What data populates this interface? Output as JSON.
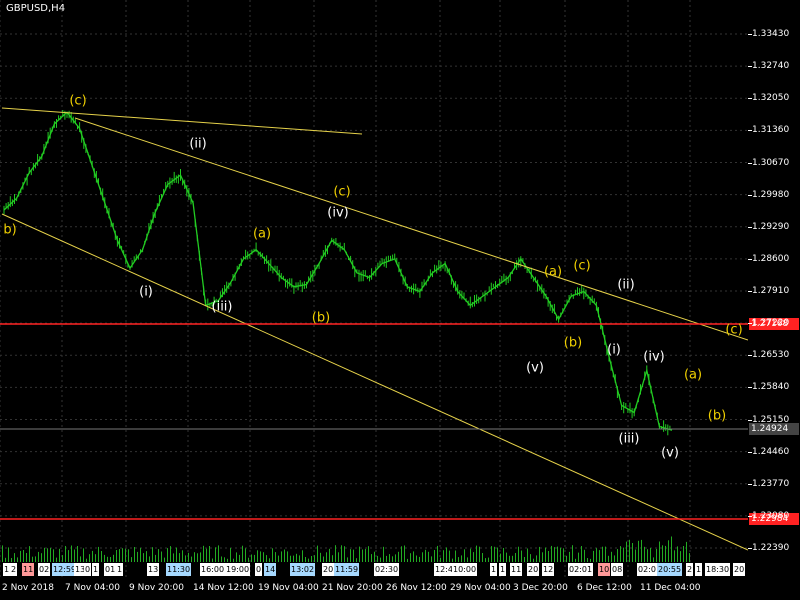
{
  "chart": {
    "title": "GBPUSD,H4",
    "colors": {
      "background": "#000000",
      "bull": "#22cc22",
      "grid": "#3a3a3a",
      "axis": "#ffffff",
      "support": "#ff2222",
      "trend": "#e6d24a",
      "wave_white": "#ffffff",
      "wave_yellow": "#f0d000"
    },
    "current_price": "1.24924",
    "level_upper": "1.27168",
    "level_lower": "1.22984",
    "tick_labels_partial": [
      "1",
      "2",
      "11",
      "02",
      "12:59",
      "13",
      "0",
      "1",
      "01",
      "1",
      "13",
      "11:30",
      "16:00",
      "19:00",
      "0",
      "14",
      "13:02",
      "20",
      "11:59",
      "02:30",
      "12:4",
      "10:00",
      "1",
      "1",
      "11",
      "20",
      "12",
      "02:01",
      "10",
      "08",
      "02:0",
      "20:55",
      "2",
      "1",
      "18:30",
      "20"
    ]
  },
  "chart_data": {
    "type": "candlestick",
    "symbol": "GBPUSD",
    "timeframe": "H4",
    "y_ticks": [
      "1.33430",
      "1.32740",
      "1.32050",
      "1.31360",
      "1.30670",
      "1.29980",
      "1.29290",
      "1.28600",
      "1.27910",
      "1.27220",
      "1.26530",
      "1.25840",
      "1.25150",
      "1.24460",
      "1.23770",
      "1.23080",
      "1.22390"
    ],
    "x_ticks": [
      "2 Nov 2018",
      "7 Nov 04:00",
      "9 Nov 20:00",
      "14 Nov 12:00",
      "19 Nov 04:00",
      "21 Nov 20:00",
      "26 Nov 12:00",
      "29 Nov 04:00",
      "3 Dec 20:00",
      "6 Dec 12:00",
      "11 Dec 04:00"
    ],
    "close_series": [
      1.2965,
      1.299,
      1.3045,
      1.308,
      1.315,
      1.3175,
      1.314,
      1.306,
      1.298,
      1.29,
      1.284,
      1.288,
      1.296,
      1.302,
      1.304,
      1.298,
      1.276,
      1.277,
      1.281,
      1.286,
      1.288,
      1.285,
      1.282,
      1.28,
      1.2805,
      1.285,
      1.29,
      1.288,
      1.283,
      1.282,
      1.285,
      1.286,
      1.28,
      1.279,
      1.283,
      1.285,
      1.279,
      1.276,
      1.278,
      1.28,
      1.282,
      1.286,
      1.282,
      1.278,
      1.273,
      1.278,
      1.279,
      1.276,
      1.265,
      1.2545,
      1.253,
      1.262,
      1.25,
      1.2492
    ],
    "horizontal_levels": [
      1.27168,
      1.22984
    ],
    "current_price": 1.24924,
    "wave_labels": [
      {
        "text": "(c)",
        "color": "yellow"
      },
      {
        "text": "b)",
        "color": "yellow"
      },
      {
        "text": "(ii)",
        "color": "white"
      },
      {
        "text": "(i)",
        "color": "white"
      },
      {
        "text": "(iii)",
        "color": "white"
      },
      {
        "text": "(a)",
        "color": "yellow"
      },
      {
        "text": "(b)",
        "color": "yellow"
      },
      {
        "text": "(c)",
        "color": "yellow"
      },
      {
        "text": "(iv)",
        "color": "white"
      },
      {
        "text": "(a)",
        "color": "yellow"
      },
      {
        "text": "(c)",
        "color": "yellow"
      },
      {
        "text": "(b)",
        "color": "yellow"
      },
      {
        "text": "(v)",
        "color": "white"
      },
      {
        "text": "(ii)",
        "color": "white"
      },
      {
        "text": "(i)",
        "color": "white"
      },
      {
        "text": "(iv)",
        "color": "white"
      },
      {
        "text": "(iii)",
        "color": "white"
      },
      {
        "text": "(v)",
        "color": "white"
      },
      {
        "text": "(a)",
        "color": "yellow"
      },
      {
        "text": "(b)",
        "color": "yellow"
      },
      {
        "text": "(c)",
        "color": "yellow"
      }
    ]
  }
}
